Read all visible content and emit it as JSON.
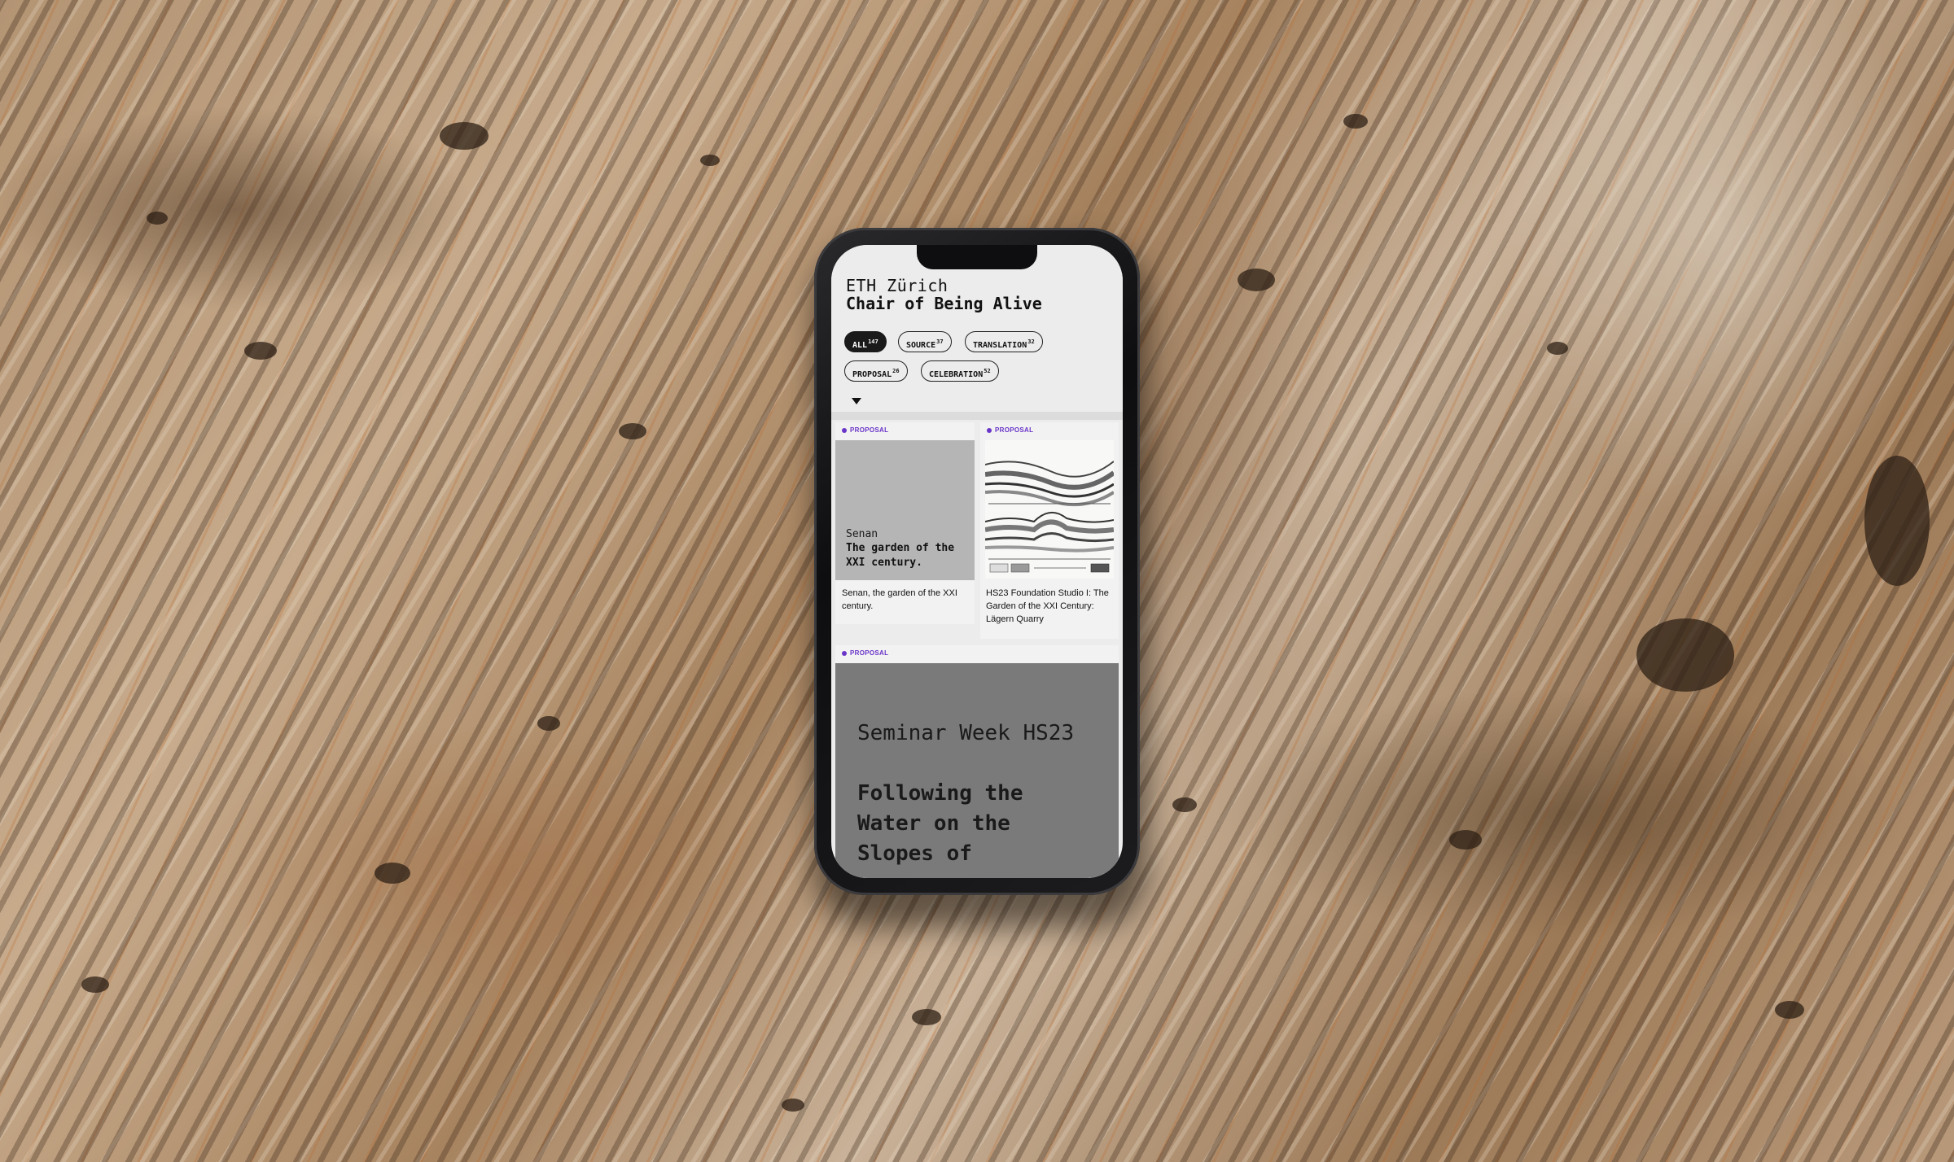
{
  "app": {
    "institution": "ETH Zürich",
    "chair": "Chair of Being Alive"
  },
  "filters": [
    {
      "label": "ALL",
      "count": "147",
      "active": true
    },
    {
      "label": "SOURCE",
      "count": "37",
      "active": false
    },
    {
      "label": "TRANSLATION",
      "count": "32",
      "active": false
    },
    {
      "label": "PROPOSAL",
      "count": "26",
      "active": false
    },
    {
      "label": "CELEBRATION",
      "count": "52",
      "active": false
    }
  ],
  "cards": [
    {
      "tag": "PROPOSAL",
      "thumb_subtitle": "Senan",
      "thumb_title": "The garden of the XXI century.",
      "caption": "Senan, the garden of the XXI century."
    },
    {
      "tag": "PROPOSAL",
      "caption": "HS23 Foundation Studio I: The Garden of the XXI Century: Lägern Quarry"
    },
    {
      "tag": "PROPOSAL",
      "thumb_subtitle": "Seminar Week HS23",
      "thumb_title": "Following the Water on the Slopes of"
    }
  ],
  "colors": {
    "accent": "#6a35c9",
    "active_chip": "#1a1a1a",
    "screen_bg": "#ececec"
  },
  "icons": {
    "expand": "caret-down-icon",
    "category_marker": "dot-icon"
  }
}
